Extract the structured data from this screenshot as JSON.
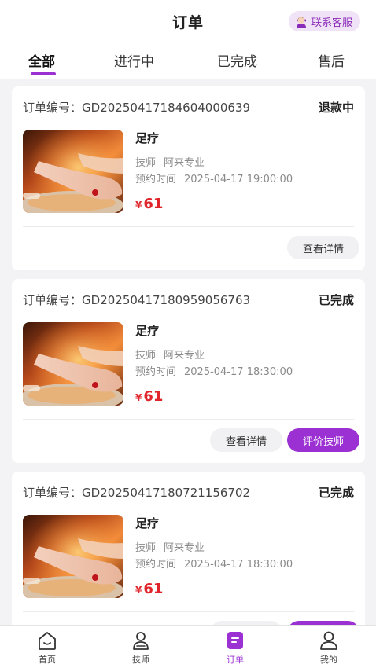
{
  "header": {
    "title": "订单",
    "customer_service_label": "联系客服"
  },
  "tabs": [
    {
      "label": "全部",
      "active": true
    },
    {
      "label": "进行中",
      "active": false
    },
    {
      "label": "已完成",
      "active": false
    },
    {
      "label": "售后",
      "active": false
    }
  ],
  "orders": [
    {
      "order_no_label": "订单编号：",
      "order_no": "GD20250417184604000639",
      "status": "退款中",
      "service": "足疗",
      "tech_label": "技师",
      "tech_name": "阿来专业",
      "time_label": "预约时间",
      "time_value": "2025-04-17 19:00:00",
      "currency": "¥",
      "price": "61",
      "detail_label": "查看详情"
    },
    {
      "order_no_label": "订单编号：",
      "order_no": "GD20250417180959056763",
      "status": "已完成",
      "service": "足疗",
      "tech_label": "技师",
      "tech_name": "阿来专业",
      "time_label": "预约时间",
      "time_value": "2025-04-17 18:30:00",
      "currency": "¥",
      "price": "61",
      "detail_label": "查看详情",
      "review_label": "评价技师"
    },
    {
      "order_no_label": "订单编号：",
      "order_no": "GD20250417180721156702",
      "status": "已完成",
      "service": "足疗",
      "tech_label": "技师",
      "tech_name": "阿来专业",
      "time_label": "预约时间",
      "time_value": "2025-04-17 18:30:00",
      "currency": "¥",
      "price": "61"
    }
  ],
  "bottom_nav": [
    {
      "label": "首页",
      "icon": "home-icon",
      "active": false
    },
    {
      "label": "技师",
      "icon": "technician-icon",
      "active": false
    },
    {
      "label": "订单",
      "icon": "order-icon",
      "active": true
    },
    {
      "label": "我的",
      "icon": "profile-icon",
      "active": false
    }
  ],
  "colors": {
    "accent": "#9b30d3",
    "price": "#e0262c",
    "background": "#f3f3f5"
  }
}
